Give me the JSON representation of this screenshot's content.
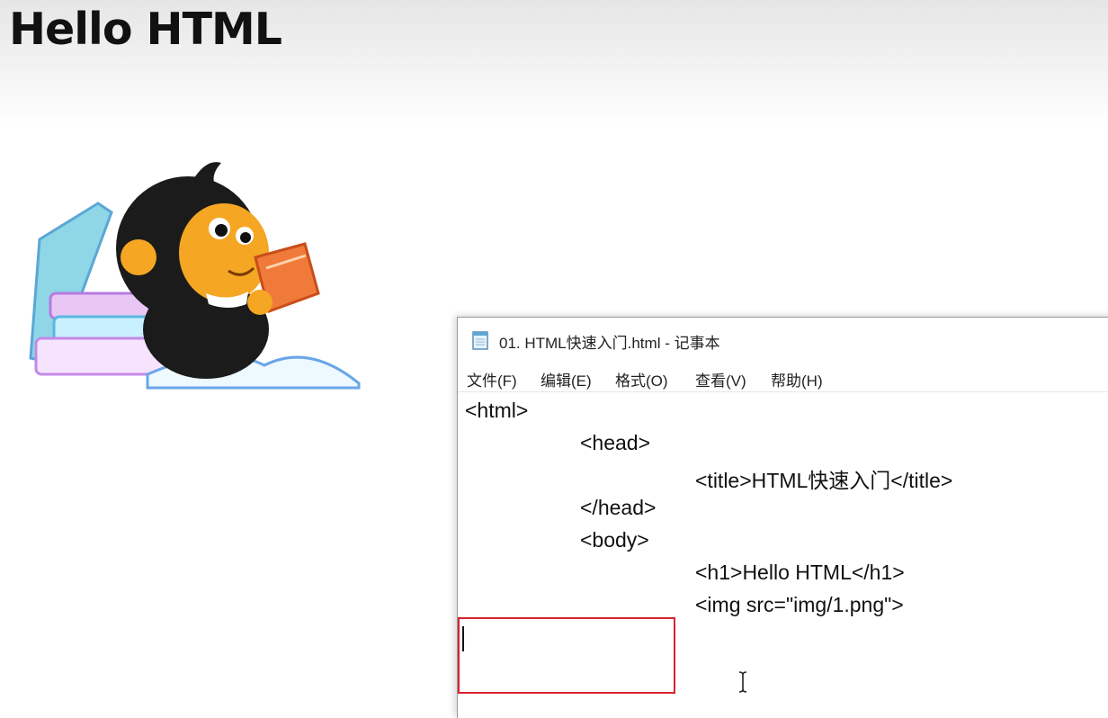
{
  "page": {
    "heading": "Hello HTML"
  },
  "notepad": {
    "title": "01. HTML快速入门.html - 记事本",
    "menu": [
      "文件(F)",
      "编辑(E)",
      "格式(O)",
      "查看(V)",
      "帮助(H)"
    ],
    "lines": [
      "<html>",
      "<head>",
      "<title>HTML快速入门</title>",
      "</head>",
      "<body>",
      "<h1>Hello HTML</h1>",
      "<img src=\"img/1.png\">"
    ]
  },
  "colors": {
    "highlight": "#d9232e",
    "mascot_body": "#1b1b1b",
    "mascot_face": "#f5a623",
    "book": "#f07a3a"
  },
  "icons": [
    "notepad-icon",
    "text-cursor-icon"
  ]
}
